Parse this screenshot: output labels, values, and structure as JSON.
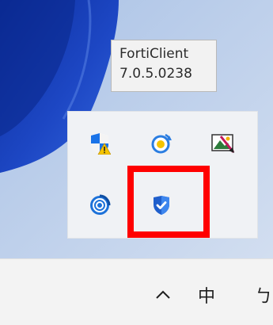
{
  "tooltip": {
    "app_name": "FortiClient",
    "version": "7.0.5.0238"
  },
  "tray": {
    "icons": [
      {
        "name": "shield-warning-icon",
        "row": 1,
        "col": 1
      },
      {
        "name": "update-agent-icon",
        "row": 1,
        "col": 2
      },
      {
        "name": "screen-capture-icon",
        "row": 1,
        "col": 3
      },
      {
        "name": "sync-swirl-icon",
        "row": 2,
        "col": 1
      },
      {
        "name": "forticlient-shield-icon",
        "row": 2,
        "col": 2,
        "highlighted": true
      }
    ],
    "highlight_color": "#ff0000"
  },
  "taskbar": {
    "chevron_icon": "chevron-up-icon",
    "ime_label": "中",
    "partial_label": "ㄅ"
  },
  "colors": {
    "wallpaper_blue": "#1a3fb8",
    "desktop_light": "#c6d6ec",
    "flyout_bg": "#f0f2f5",
    "taskbar_bg": "#f3f3f3"
  }
}
